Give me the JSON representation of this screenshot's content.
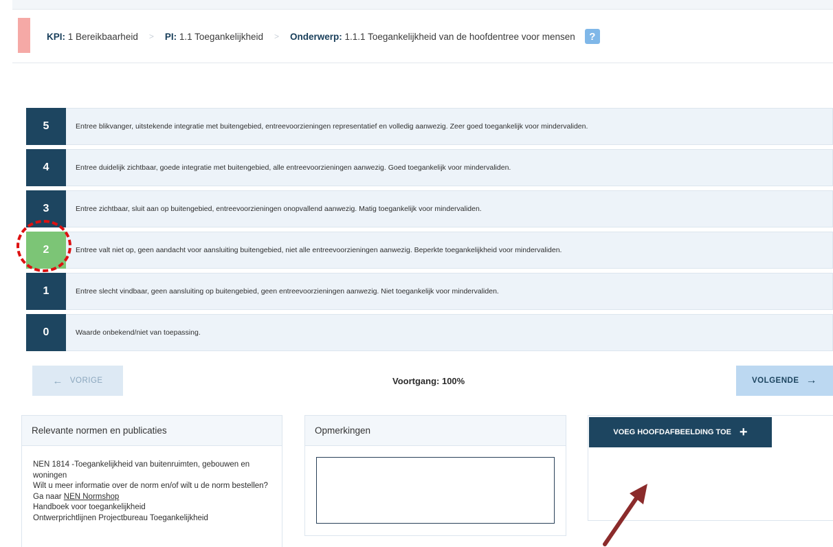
{
  "breadcrumb": {
    "kpi_label": "KPI:",
    "kpi_value": "1 Bereikbaarheid",
    "pi_label": "PI:",
    "pi_value": "1.1 Toegankelijkheid",
    "subject_label": "Onderwerp:",
    "subject_value": "1.1.1 Toegankelijkheid van de hoofdentree voor mensen",
    "separator": ">",
    "help": "?"
  },
  "levels": [
    {
      "score": "5",
      "text": "Entree blikvanger, uitstekende integratie met buitengebied, entreevoorzieningen representatief en volledig aanwezig. Zeer goed toegankelijk voor mindervaliden."
    },
    {
      "score": "4",
      "text": "Entree duidelijk zichtbaar, goede integratie met buitengebied, alle entreevoorzieningen aanwezig. Goed toegankelijk voor mindervaliden."
    },
    {
      "score": "3",
      "text": "Entree zichtbaar, sluit aan op buitengebied, entreevoorzieningen onopvallend aanwezig. Matig toegankelijk voor mindervaliden."
    },
    {
      "score": "2",
      "text": "Entree valt niet op, geen aandacht voor aansluiting buitengebied, niet alle entreevoorzieningen aanwezig. Beperkte toegankelijkheid voor mindervaliden."
    },
    {
      "score": "1",
      "text": "Entree slecht vindbaar, geen aansluiting op buitengebied, geen entreevoorzieningen aanwezig. Niet toegankelijk voor mindervaliden."
    },
    {
      "score": "0",
      "text": "Waarde onbekend/niet van toepassing."
    }
  ],
  "selected_score": "2",
  "nav": {
    "prev_label": "VORIGE",
    "progress": "Voortgang: 100%",
    "next_label": "VOLGENDE"
  },
  "norms": {
    "title": "Relevante normen en publicaties",
    "line1": "NEN 1814 -Toegankelijkheid van buitenruimten, gebouwen en woningen",
    "line2_prefix": "Wilt u meer informatie over de norm en/of wilt u de norm bestellen? Ga naar",
    "line2_link": "NEN Normshop",
    "line3": "Handboek voor toegankelijkheid",
    "line4": "Ontwerprichtlijnen Projectbureau Toegankelijkheid"
  },
  "comments": {
    "title": "Opmerkingen",
    "value": ""
  },
  "image": {
    "add_label": "VOEG HOOFDAFBEELDING TOE"
  },
  "colors": {
    "navy": "#1d4560",
    "selected_green": "#7cc576",
    "annotation_red": "#dd1111",
    "annotation_arrow": "#8b2b2b",
    "flag_pink": "#f5a9a6"
  }
}
